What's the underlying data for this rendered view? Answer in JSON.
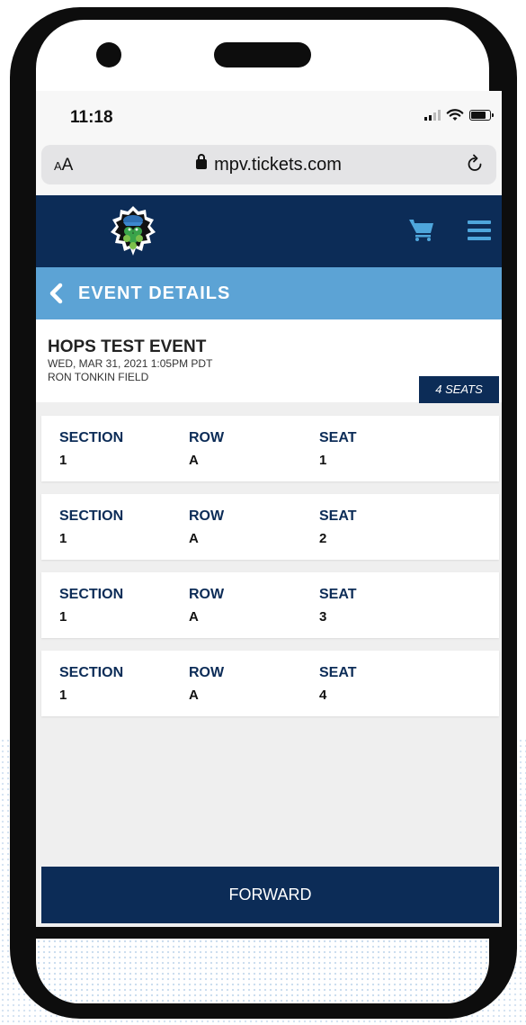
{
  "status": {
    "time": "11:18"
  },
  "browser": {
    "text_size_small": "A",
    "text_size_large": "A",
    "url": "mpv.tickets.com"
  },
  "nav": {
    "logo": "hillsboro-hops-logo",
    "cart_icon": "cart-icon",
    "menu_icon": "hamburger-menu-icon"
  },
  "header": {
    "title": "EVENT DETAILS"
  },
  "event": {
    "name": "HOPS TEST EVENT",
    "datetime": "WED, MAR 31, 2021 1:05PM PDT",
    "venue": "RON TONKIN FIELD",
    "seat_count_label": "4 SEATS"
  },
  "seats": [
    {
      "section_label": "SECTION",
      "section": "1",
      "row_label": "ROW",
      "row": "A",
      "seat_label": "SEAT",
      "seat": "1"
    },
    {
      "section_label": "SECTION",
      "section": "1",
      "row_label": "ROW",
      "row": "A",
      "seat_label": "SEAT",
      "seat": "2"
    },
    {
      "section_label": "SECTION",
      "section": "1",
      "row_label": "ROW",
      "row": "A",
      "seat_label": "SEAT",
      "seat": "3"
    },
    {
      "section_label": "SECTION",
      "section": "1",
      "row_label": "ROW",
      "row": "A",
      "seat_label": "SEAT",
      "seat": "4"
    }
  ],
  "actions": {
    "forward_label": "FORWARD"
  },
  "colors": {
    "navy": "#0c2c57",
    "header_blue": "#5ca3d5",
    "accent_blue": "#4ea6dc"
  }
}
